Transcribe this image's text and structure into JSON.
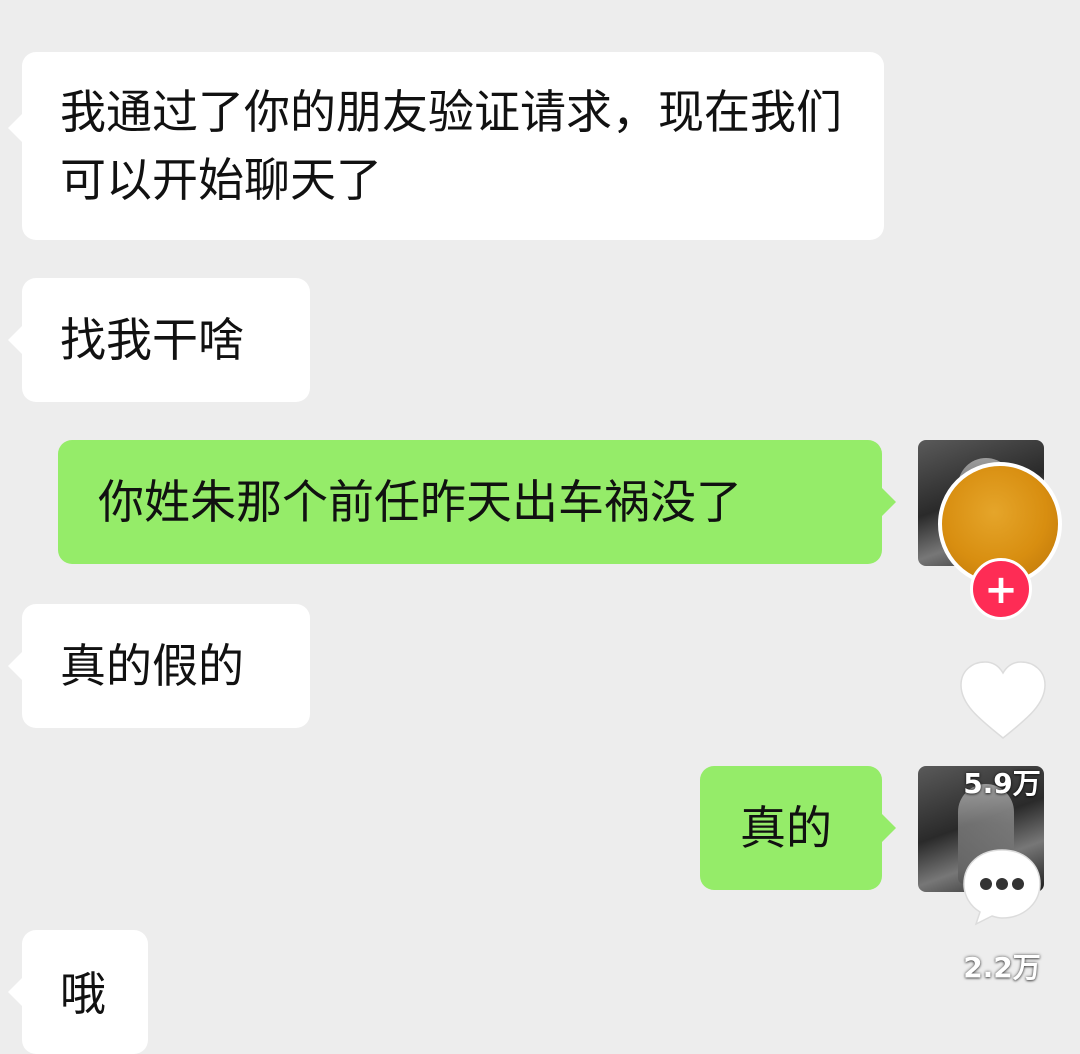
{
  "messages": [
    {
      "side": "left",
      "text": "我通过了你的朋友验证请求，现在我们可以开始聊天了"
    },
    {
      "side": "left",
      "text": "找我干啥"
    },
    {
      "side": "right",
      "text": "你姓朱那个前任昨天出车祸没了"
    },
    {
      "side": "left",
      "text": "真的假的"
    },
    {
      "side": "right",
      "text": "真的"
    },
    {
      "side": "left",
      "text": "哦"
    }
  ],
  "overlay": {
    "follow_symbol": "+",
    "like_count": "5.9万",
    "comment_count": "2.2万",
    "icons": [
      "heart-icon",
      "comment-icon",
      "plus-icon"
    ]
  },
  "colors": {
    "background": "#ededed",
    "incoming_bubble": "#ffffff",
    "outgoing_bubble": "#95ec69",
    "follow_button": "#fe2c55"
  }
}
